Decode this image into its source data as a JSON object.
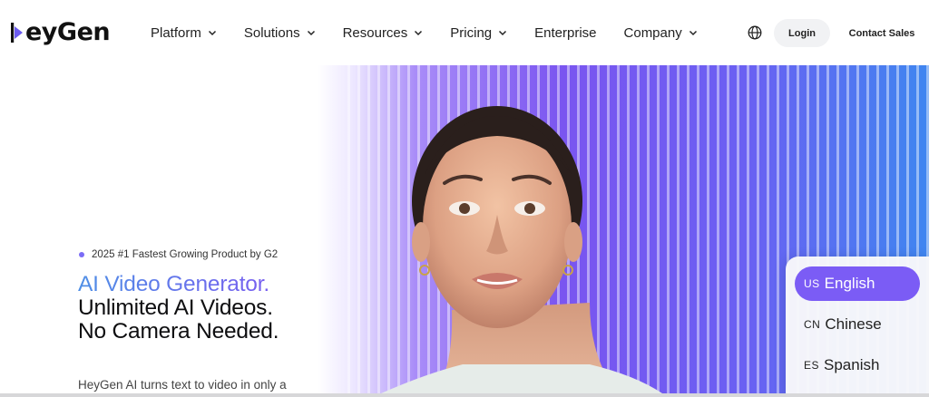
{
  "header": {
    "logo_text": "eyGen",
    "nav": [
      {
        "label": "Platform",
        "has_dropdown": true
      },
      {
        "label": "Solutions",
        "has_dropdown": true
      },
      {
        "label": "Resources",
        "has_dropdown": true
      },
      {
        "label": "Pricing",
        "has_dropdown": true
      },
      {
        "label": "Enterprise",
        "has_dropdown": false
      },
      {
        "label": "Company",
        "has_dropdown": true
      }
    ],
    "globe_icon": "globe-icon",
    "login_label": "Login",
    "contact_label": "Contact Sales"
  },
  "hero": {
    "badge": "2025 #1 Fastest Growing Product by G2",
    "headline_1": "AI Video Generator.",
    "headline_2": "Unlimited AI Videos.",
    "headline_3": "No Camera Needed.",
    "description": "HeyGen AI turns text to video in only a"
  },
  "language_menu": {
    "items": [
      {
        "code": "us",
        "label": "English",
        "active": true
      },
      {
        "code": "cn",
        "label": "Chinese",
        "active": false
      },
      {
        "code": "es",
        "label": "Spanish",
        "active": false
      }
    ]
  },
  "colors": {
    "accent": "#7b5cf5",
    "headline_gradient_start": "#4f8fe6",
    "headline_gradient_end": "#7a5cf0",
    "badge_dot": "#7b6cf6"
  }
}
